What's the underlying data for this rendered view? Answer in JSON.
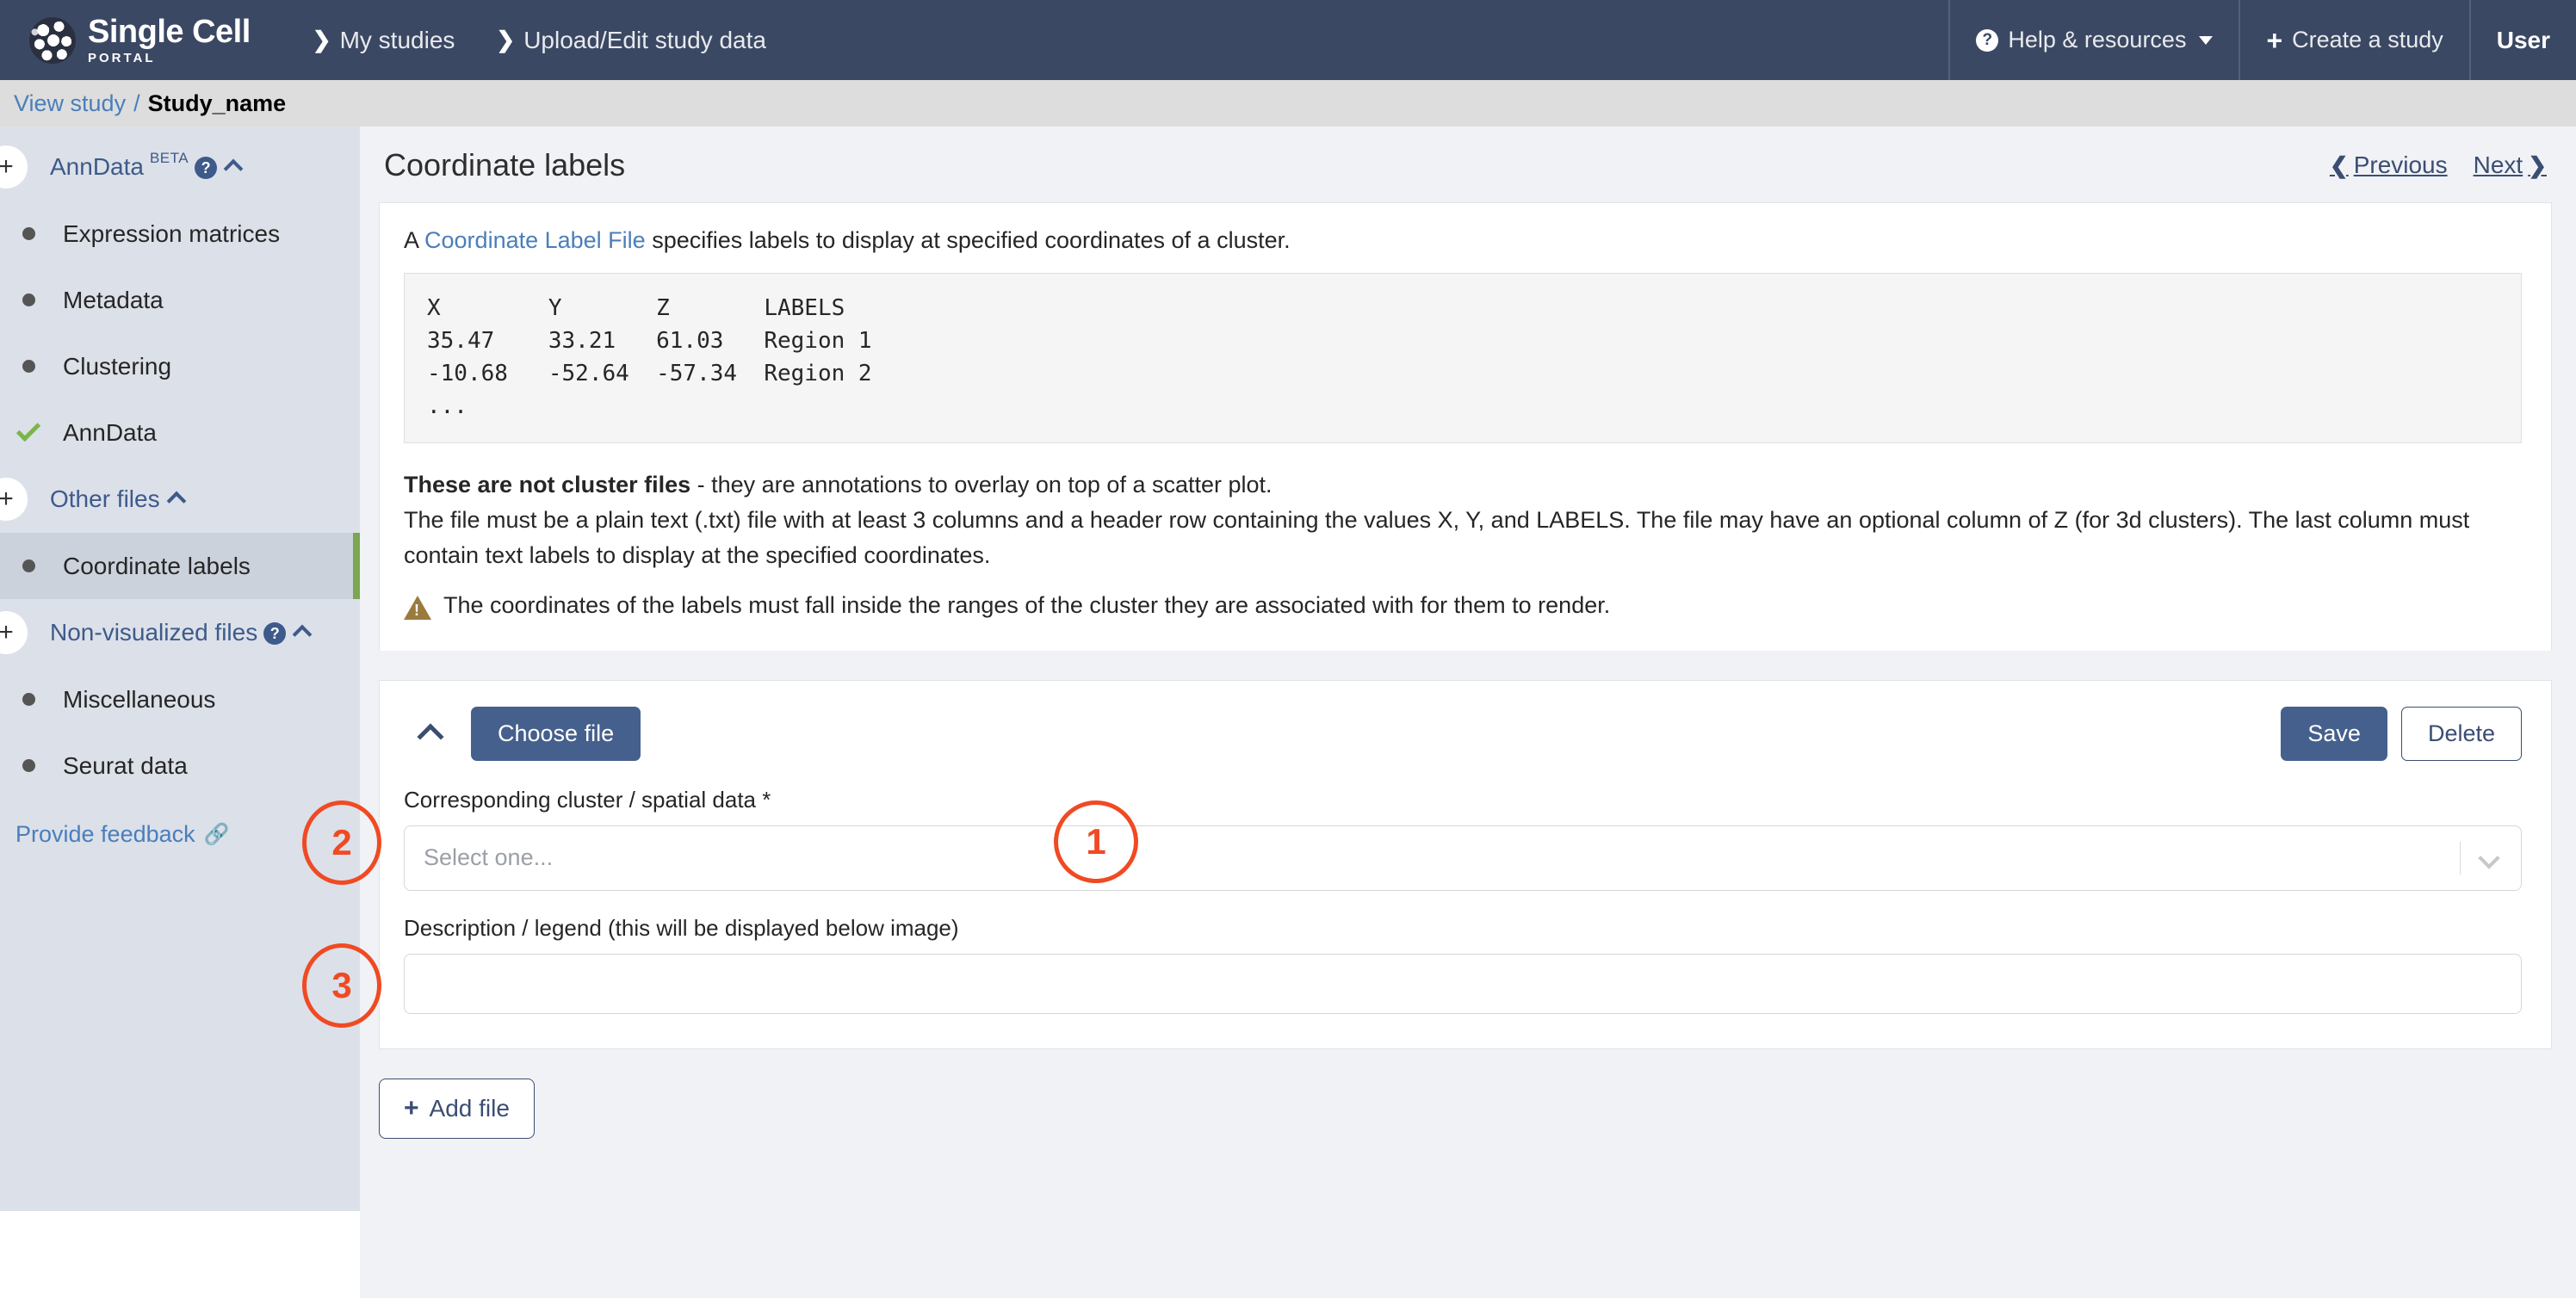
{
  "topnav": {
    "brand_title": "Single Cell",
    "brand_sub": "PORTAL",
    "links": [
      {
        "label": "My studies",
        "icon": "chevron-right-icon"
      },
      {
        "label": "Upload/Edit study data",
        "icon": "chevron-right-icon"
      }
    ],
    "help_label": "Help & resources",
    "create_label": "Create a study",
    "user_label": "User",
    "bg_color": "#3b4863"
  },
  "breadcrumb": {
    "view_study": "View study",
    "separator": "/",
    "study_name": "Study_name"
  },
  "sidebar": {
    "groups": [
      {
        "label": "AnnData",
        "badge": "BETA",
        "has_help": true,
        "items": [
          {
            "label": "Expression matrices",
            "state": "dot"
          },
          {
            "label": "Metadata",
            "state": "dot"
          },
          {
            "label": "Clustering",
            "state": "dot"
          },
          {
            "label": "AnnData",
            "state": "check"
          }
        ]
      },
      {
        "label": "Other files",
        "badge": "",
        "has_help": false,
        "items": [
          {
            "label": "Coordinate labels",
            "state": "dot",
            "active": true
          }
        ]
      },
      {
        "label": "Non-visualized files",
        "badge": "",
        "has_help": true,
        "items": [
          {
            "label": "Miscellaneous",
            "state": "dot"
          },
          {
            "label": "Seurat data",
            "state": "dot"
          }
        ]
      }
    ],
    "feedback_label": "Provide feedback",
    "accent_color": "#7ba750"
  },
  "main": {
    "title": "Coordinate labels",
    "prev_label": "Previous",
    "next_label": "Next",
    "intro_prefix": "A ",
    "intro_link": "Coordinate Label File",
    "intro_suffix": " specifies labels to display at specified coordinates of a cluster.",
    "code_sample": "X        Y       Z       LABELS\n35.47    33.21   61.03   Region 1\n-10.68   -52.64  -57.34  Region 2\n...",
    "para1_bold": "These are not cluster files",
    "para1_rest": " - they are annotations to overlay on top of a scatter plot.",
    "para2": "The file must be a plain text (.txt) file with at least 3 columns and a header row containing the values X, Y, and LABELS. The file may have an optional column of Z (for 3d clusters). The last column must contain text labels to display at the specified coordinates.",
    "warning": "The coordinates of the labels must fall inside the ranges of the cluster they are associated with for them to render."
  },
  "form": {
    "choose_file_label": "Choose file",
    "save_label": "Save",
    "delete_label": "Delete",
    "cluster_field_label": "Corresponding cluster / spatial data *",
    "cluster_field_placeholder": "Select one...",
    "description_field_label": "Description / legend (this will be displayed below image)",
    "description_field_value": "",
    "add_file_label": "Add file"
  },
  "annotations": [
    {
      "number": "1"
    },
    {
      "number": "2"
    },
    {
      "number": "3"
    }
  ]
}
